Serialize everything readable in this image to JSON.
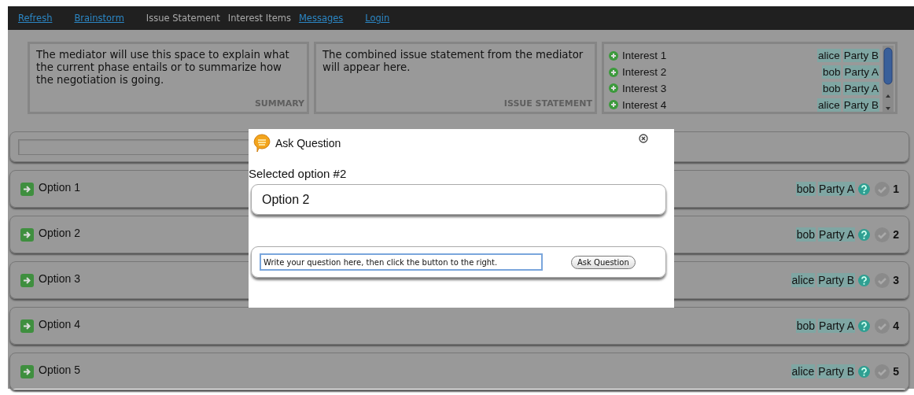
{
  "nav": [
    {
      "label": "Refresh",
      "disabled": false
    },
    {
      "label": "Brainstorm",
      "disabled": false
    },
    {
      "label": "Issue Statement",
      "disabled": true
    },
    {
      "label": "Interest Items",
      "disabled": true
    },
    {
      "label": "Messages",
      "disabled": false
    },
    {
      "label": "Login",
      "disabled": false
    }
  ],
  "summary": {
    "text": "The mediator will use this space to explain what the current phase entails or to summarize how the negotiation is going.",
    "caption": "SUMMARY"
  },
  "issue_statement": {
    "text": "The combined issue statement from the mediator will appear here.",
    "caption": "ISSUE STATEMENT"
  },
  "interests": [
    {
      "label": "Interest 1",
      "user": "alice",
      "party": "Party B"
    },
    {
      "label": "Interest 2",
      "user": "bob",
      "party": "Party A"
    },
    {
      "label": "Interest 3",
      "user": "bob",
      "party": "Party A"
    },
    {
      "label": "Interest 4",
      "user": "alice",
      "party": "Party B"
    }
  ],
  "options": [
    {
      "label": "Option 1",
      "user": "bob",
      "party": "Party A",
      "number": "1"
    },
    {
      "label": "Option 2",
      "user": "bob",
      "party": "Party A",
      "number": "2"
    },
    {
      "label": "Option 3",
      "user": "alice",
      "party": "Party B",
      "number": "3"
    },
    {
      "label": "Option 4",
      "user": "bob",
      "party": "Party A",
      "number": "4"
    },
    {
      "label": "Option 5",
      "user": "alice",
      "party": "Party B",
      "number": "5"
    }
  ],
  "dialog": {
    "title": "Ask Question",
    "heading": "Selected option #2",
    "selected_option": "Option 2",
    "question": "Write your question here, then click the button to the right.",
    "button": "Ask Question"
  }
}
